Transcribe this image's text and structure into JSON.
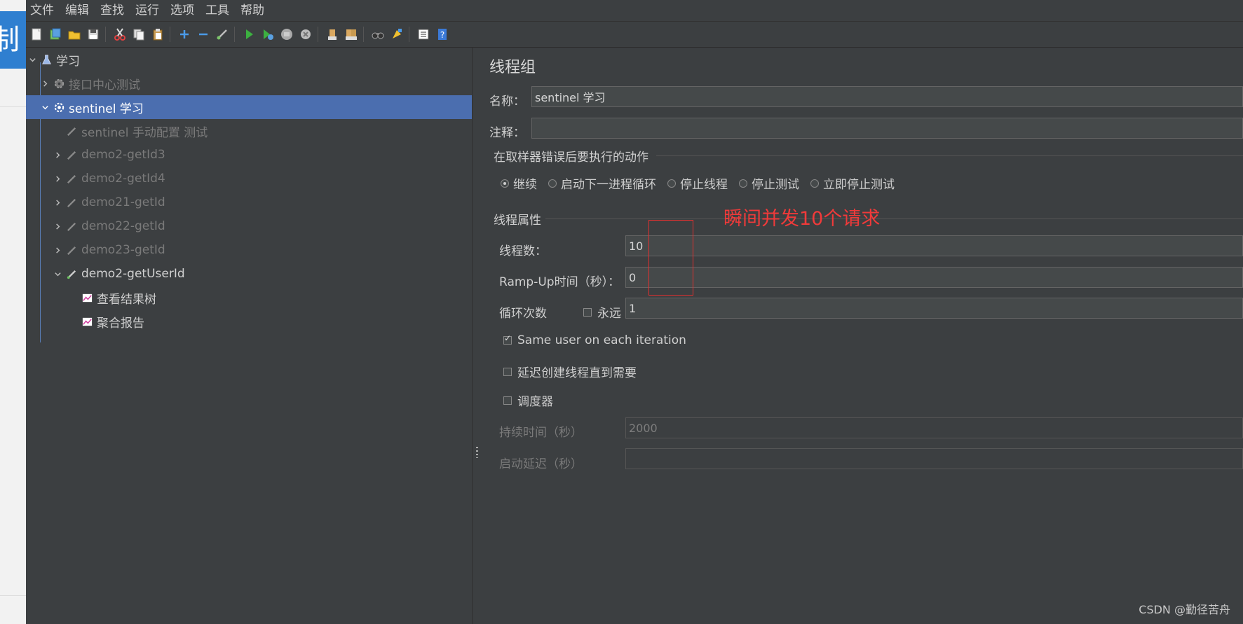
{
  "background_strip": {
    "badge_text": "制"
  },
  "menubar": {
    "items": [
      "文件",
      "编辑",
      "查找",
      "运行",
      "选项",
      "工具",
      "帮助"
    ]
  },
  "toolbar": {
    "icons": [
      "new-icon",
      "templates-icon",
      "open-icon",
      "save-icon",
      "cut-icon",
      "copy-icon",
      "paste-icon",
      "expand-icon",
      "collapse-icon",
      "toggle-icon",
      "start-icon",
      "start-no-pause-icon",
      "stop-icon",
      "shutdown-icon",
      "clear-icon",
      "clear-all-icon",
      "search-icon",
      "reset-search-icon",
      "function-helper-icon",
      "help-icon"
    ]
  },
  "tree": {
    "root": "学习",
    "items": [
      {
        "label": "接口中心测试",
        "state": "disabled"
      },
      {
        "label": "sentinel 学习",
        "state": "selected"
      },
      {
        "label": "sentinel 手动配置 测试",
        "state": "disabled"
      },
      {
        "label": "demo2-getId3",
        "state": "disabled"
      },
      {
        "label": "demo2-getId4",
        "state": "disabled"
      },
      {
        "label": "demo21-getId",
        "state": "disabled"
      },
      {
        "label": "demo22-getId",
        "state": "disabled"
      },
      {
        "label": "demo23-getId",
        "state": "disabled"
      },
      {
        "label": "demo2-getUserId",
        "state": "active"
      },
      {
        "label": "查看结果树",
        "state": "active"
      },
      {
        "label": "聚合报告",
        "state": "active"
      }
    ]
  },
  "panel": {
    "title": "线程组",
    "name_label": "名称：",
    "name_value": "sentinel 学习",
    "comment_label": "注释：",
    "comment_value": "",
    "error_action_group": "在取样器错误后要执行的动作",
    "error_actions": [
      {
        "label": "继续",
        "selected": true
      },
      {
        "label": "启动下一进程循环",
        "selected": false
      },
      {
        "label": "停止线程",
        "selected": false
      },
      {
        "label": "停止测试",
        "selected": false
      },
      {
        "label": "立即停止测试",
        "selected": false
      }
    ],
    "thread_props_group": "线程属性",
    "threads_label": "线程数：",
    "threads_value": "10",
    "rampup_label": "Ramp-Up时间（秒）：",
    "rampup_value": "0",
    "loop_label": "循环次数",
    "forever_label": "永远",
    "forever_checked": false,
    "loop_value": "1",
    "same_user_label": "Same user on each iteration",
    "same_user_checked": true,
    "delay_label": "延迟创建线程直到需要",
    "delay_checked": false,
    "scheduler_label": "调度器",
    "scheduler_checked": false,
    "duration_label": "持续时间（秒）",
    "duration_value": "2000",
    "startup_delay_label": "启动延迟（秒）",
    "startup_delay_value": ""
  },
  "annotation": {
    "text": "瞬间并发10个请求",
    "color": "#f03a3a"
  },
  "watermark": "CSDN @勤径苦舟",
  "colors": {
    "background": "#3c3f41",
    "selection": "#4b6eaf",
    "field": "#45494a"
  }
}
